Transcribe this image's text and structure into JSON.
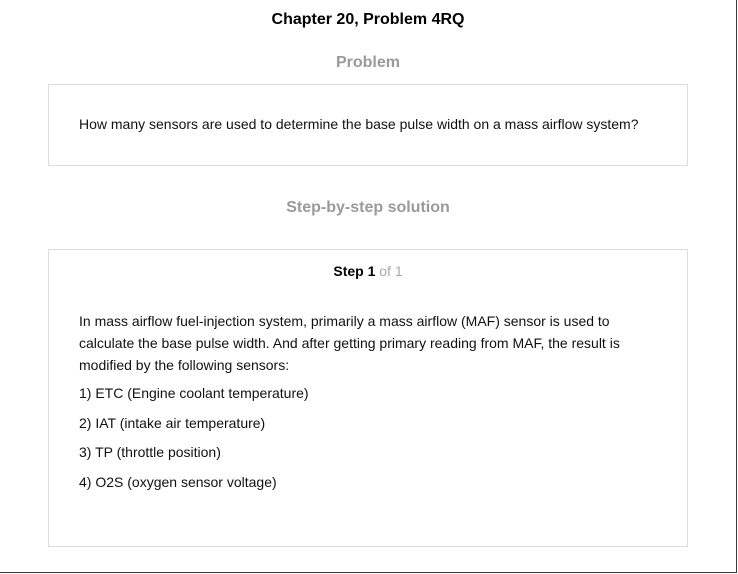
{
  "header": {
    "chapter_title": "Chapter 20, Problem 4RQ"
  },
  "problem": {
    "heading": "Problem",
    "text": "How many sensors are used to determine the base pulse width on a mass airflow system?"
  },
  "solution": {
    "heading": "Step-by-step solution",
    "step": {
      "label": "Step 1",
      "of_label": "of 1"
    },
    "paragraph": "In mass airflow fuel-injection system, primarily a mass airflow (MAF) sensor is used to calculate the base pulse width. And after getting primary reading from MAF, the result is modified by the following sensors:",
    "sensors": [
      "1) ETC (Engine coolant temperature)",
      "2) IAT (intake air temperature)",
      "3) TP (throttle position)",
      "4) O2S (oxygen sensor voltage)"
    ]
  }
}
